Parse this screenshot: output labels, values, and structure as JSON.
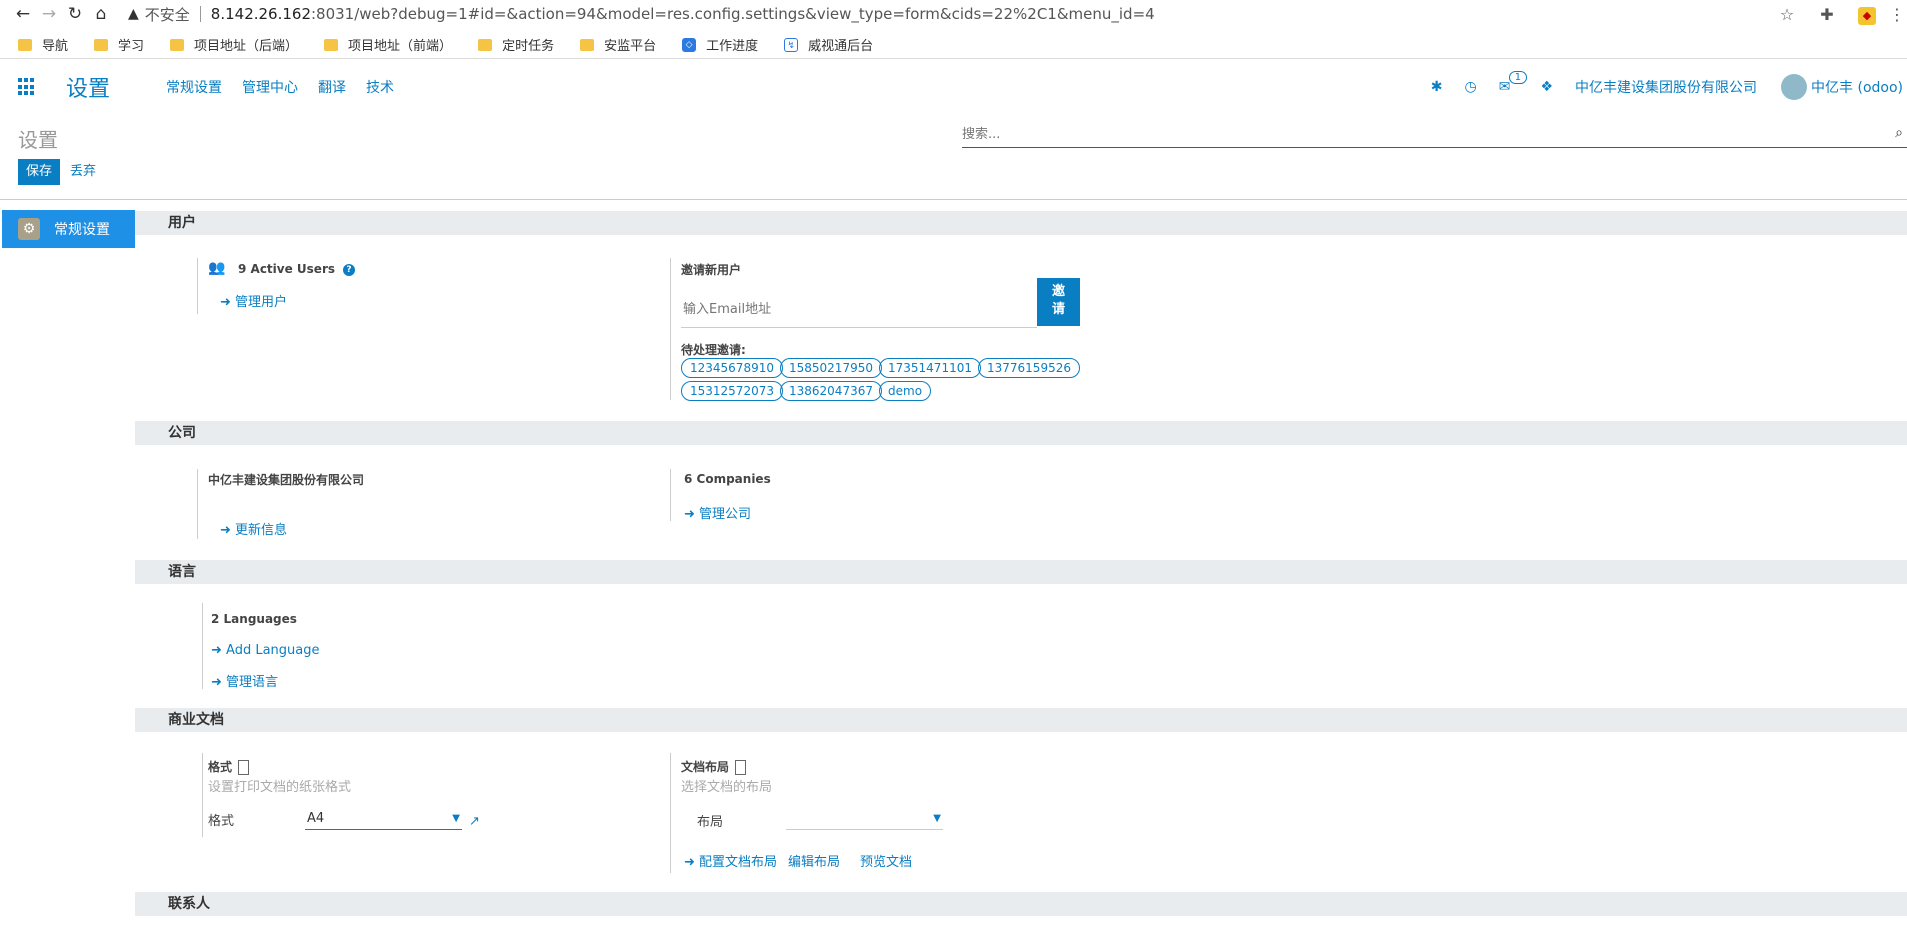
{
  "browser": {
    "insecure_label": "不安全",
    "url_host": "8.142.26.162",
    "url_rest": ":8031/web?debug=1#id=&action=94&model=res.config.settings&view_type=form&cids=22%2C1&menu_id=4",
    "bookmarks": [
      "导航",
      "学习",
      "项目地址（后端）",
      "项目地址（前端）",
      "定时任务",
      "安监平台",
      "工作进度",
      "威视通后台"
    ]
  },
  "navbar": {
    "brand": "设置",
    "menu": [
      "常规设置",
      "管理中心",
      "翻译",
      "技术"
    ],
    "message_count": "1",
    "company": "中亿丰建设集团股份有限公司",
    "user": "中亿丰 (odoo)"
  },
  "control_panel": {
    "title": "设置",
    "search_placeholder": "搜索...",
    "save_label": "保存",
    "discard_label": "丢弃"
  },
  "sidebar": {
    "items": [
      {
        "label": "常规设置"
      }
    ]
  },
  "users": {
    "header": "用户",
    "active_users": "9 Active Users",
    "manage_users": "管理用户",
    "invite_title": "邀请新用户",
    "email_placeholder": "输入Email地址",
    "invite_button": "邀请",
    "pending_label": "待处理邀请:",
    "pending": [
      "12345678910",
      "15850217950",
      "17351471101",
      "13776159526",
      "15312572073",
      "13862047367",
      "demo"
    ]
  },
  "company": {
    "header": "公司",
    "name": "中亿丰建设集团股份有限公司",
    "update_info": "更新信息",
    "count": "6 Companies",
    "manage": "管理公司"
  },
  "languages": {
    "header": "语言",
    "count": "2 Languages",
    "add": "Add Language",
    "manage": "管理语言"
  },
  "business_docs": {
    "header": "商业文档",
    "format_title": "格式",
    "format_desc": "设置打印文档的纸张格式",
    "format_label": "格式",
    "format_value": "A4",
    "layout_title": "文档布局",
    "layout_desc": "选择文档的布局",
    "layout_label": "布局",
    "configure_layout": "配置文档布局",
    "edit_layout": "编辑布局",
    "preview": "预览文档"
  },
  "contacts": {
    "header": "联系人"
  }
}
